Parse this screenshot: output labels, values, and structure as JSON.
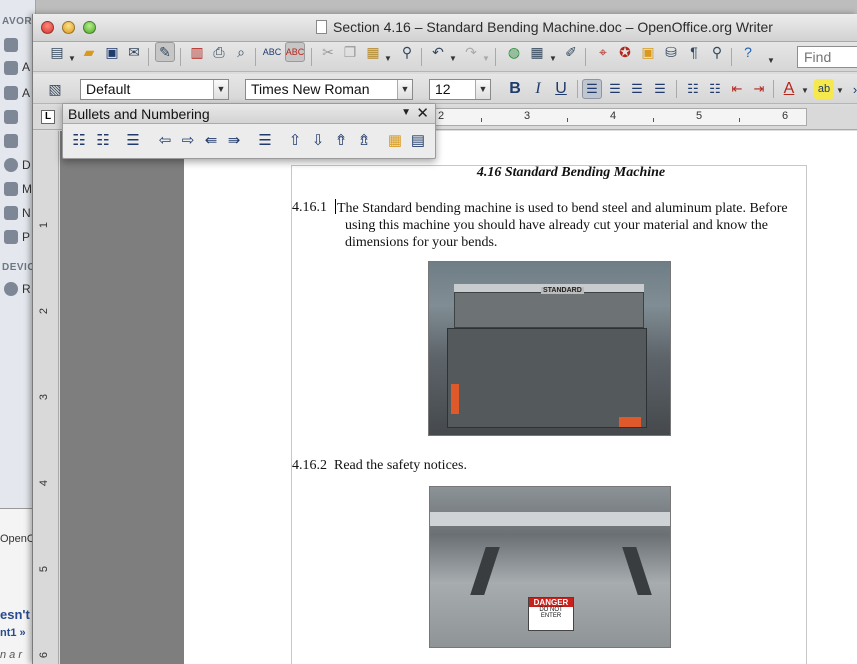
{
  "window": {
    "title": "Section 4.16 – Standard Bending Machine.doc – OpenOffice.org Writer"
  },
  "background_app": {
    "sidebar_headers": [
      "AVOR",
      "DEVIC"
    ],
    "sidebar_letters": [
      "A",
      "A",
      "D",
      "M",
      "N",
      "P",
      "R"
    ],
    "bottom_texts": [
      "OpenO",
      "esn't",
      "nt1 »",
      "n a r"
    ]
  },
  "toolbar_standard": {
    "find_placeholder": "Find",
    "icons": [
      "new-icon",
      "open-icon",
      "save-icon",
      "email-icon",
      "edit-mode-icon",
      "pdf-icon",
      "print-icon",
      "print-preview-icon",
      "spellcheck-icon",
      "autospell-icon",
      "cut-icon",
      "copy-icon",
      "paste-icon",
      "clone-format-icon",
      "undo-icon",
      "redo-icon",
      "hyperlink-icon",
      "table-icon",
      "draw-icon",
      "navigator-icon",
      "gallery-icon",
      "data-sources-icon",
      "nonprinting-chars-icon",
      "zoom-icon",
      "help-icon"
    ]
  },
  "toolbar_formatting": {
    "paragraph_style": "Default",
    "font_name": "Times New Roman",
    "font_size": "12",
    "bold_label": "B",
    "italic_label": "I",
    "underline_label": "U"
  },
  "ruler": {
    "numbers": [
      "2",
      "3",
      "4",
      "5",
      "6"
    ],
    "vertical_numbers": [
      "1",
      "2",
      "3",
      "4",
      "5",
      "6"
    ],
    "corner_label": "L"
  },
  "bullets_palette": {
    "title": "Bullets and Numbering",
    "close_label": "✕",
    "menu_label": "▼"
  },
  "document": {
    "section_title": "4.16     Standard Bending Machine",
    "paragraphs": [
      {
        "number": "4.16.1",
        "text": "The Standard bending machine is used to bend steel and aluminum plate.  Before using this machine you should have already cut your material and know the dimensions for your bends."
      },
      {
        "number": "4.16.2",
        "text": "Read the safety notices."
      }
    ],
    "photo1_label": "STANDARD",
    "photo2_sign": [
      "DANGER",
      "DO NOT ENTER"
    ]
  },
  "colors": {
    "accent": "#1f3a6b",
    "page": "#ffffff",
    "doc_bg": "#7e7e7e"
  }
}
